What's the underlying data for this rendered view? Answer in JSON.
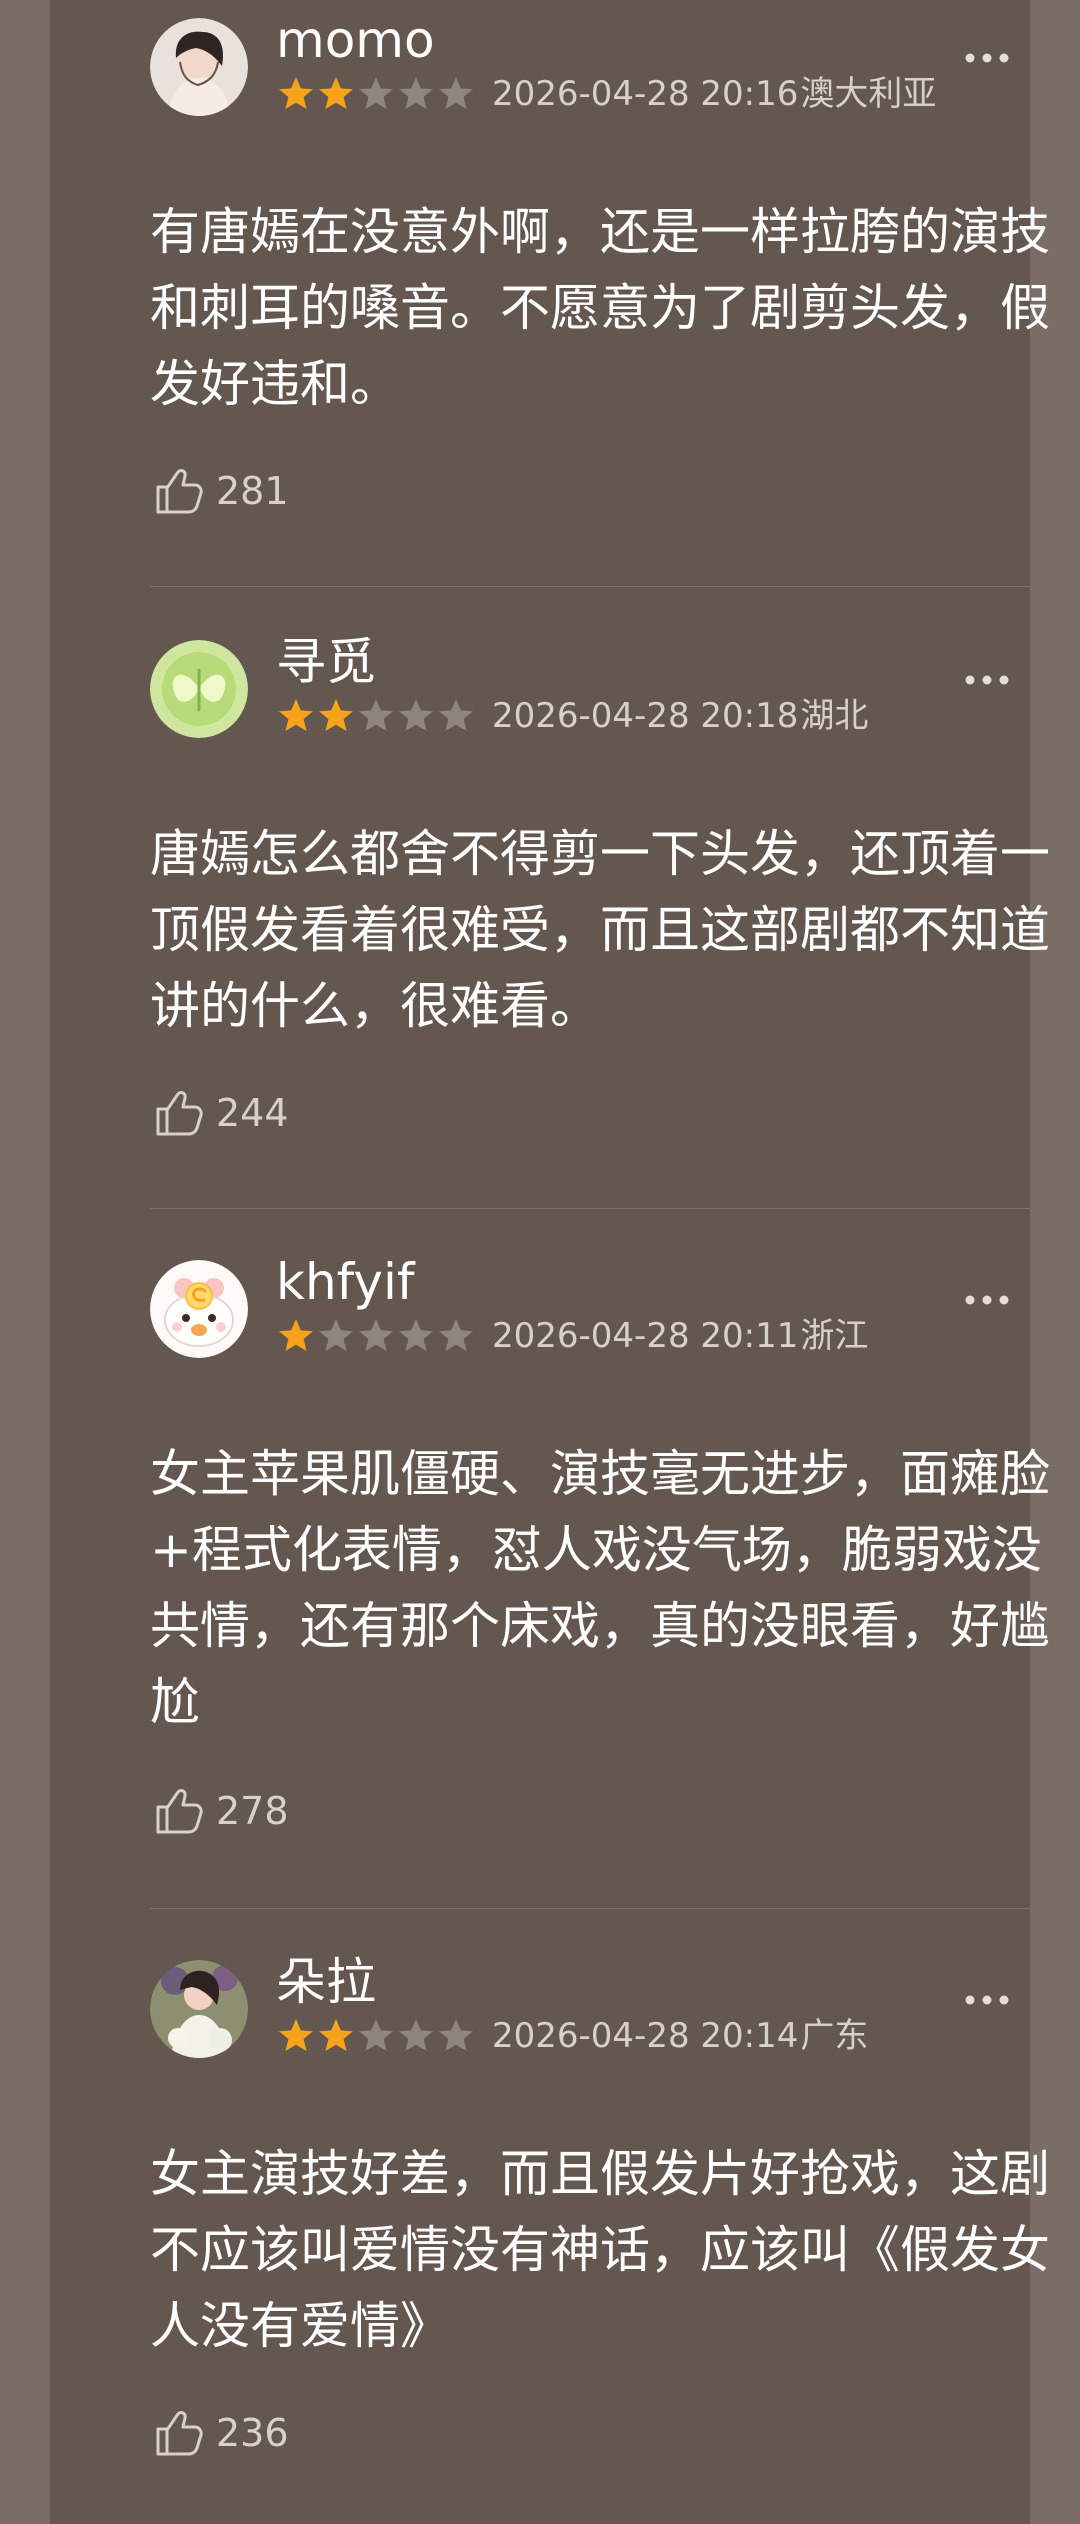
{
  "reviews": [
    {
      "username": "momo",
      "stars": 2,
      "datetime": "2026-04-28 20:16",
      "location": "澳大利亚",
      "content": "有唐嫣在没意外啊，还是一样拉胯的演技和刺耳的嗓音。不愿意为了剧剪头发，假发好违和。",
      "likes": "281"
    },
    {
      "username": "寻觅",
      "stars": 2,
      "datetime": "2026-04-28 20:18",
      "location": "湖北",
      "content": "唐嫣怎么都舍不得剪一下头发，还顶着一顶假发看着很难受，而且这部剧都不知道讲的什么，很难看。",
      "likes": "244"
    },
    {
      "username": "khfyif",
      "stars": 1,
      "datetime": "2026-04-28 20:11",
      "location": "浙江",
      "content": "女主苹果肌僵硬、演技毫无进步，面瘫脸+程式化表情，怼人戏没气场，脆弱戏没共情，还有那个床戏，真的没眼看，好尴尬",
      "likes": "278"
    },
    {
      "username": "朵拉",
      "stars": 2,
      "datetime": "2026-04-28 20:14",
      "location": "广东",
      "content": "女主演技好差，而且假发片好抢戏，这剧不应该叫爱情没有神话，应该叫《假发女人没有爱情》",
      "likes": "236"
    }
  ],
  "colors": {
    "page_background": "#7a6d66",
    "panel_background": "#645750",
    "star_filled": "#f7a21b",
    "star_empty": "#8f8580",
    "meta_text": "#d8d0ca"
  },
  "icons": {
    "more": "more-horizontal-icon",
    "like": "thumbs-up-icon",
    "star": "star-icon"
  }
}
